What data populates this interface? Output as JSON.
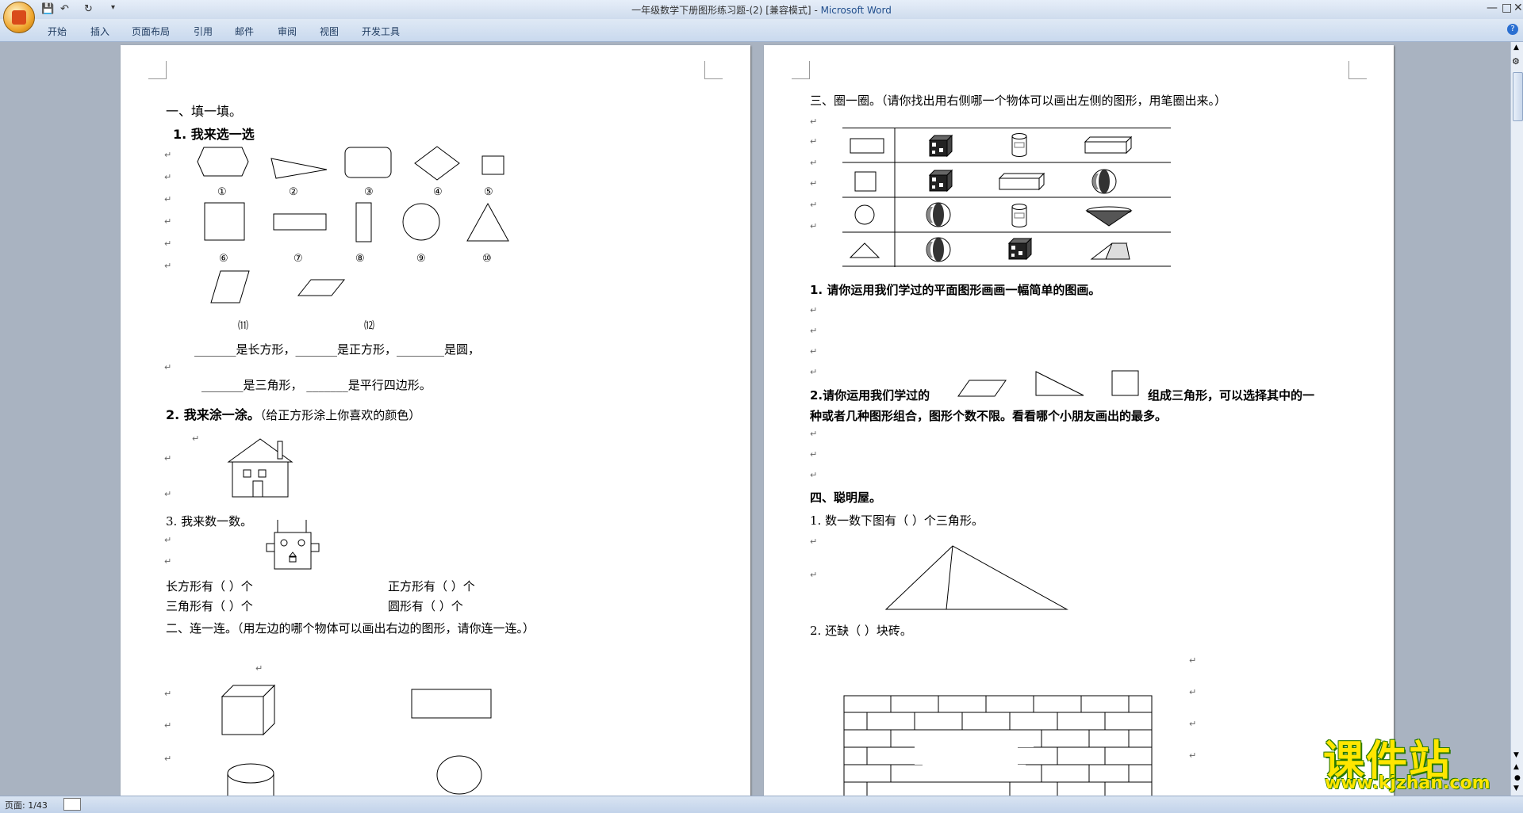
{
  "window": {
    "title": "一年级数学下册图形练习题-(2) [兼容模式]",
    "app_name": "Microsoft Word",
    "quick_access": [
      "save-icon",
      "undo-icon",
      "redo-icon",
      "customize-icon"
    ]
  },
  "menu": {
    "items": [
      "开始",
      "插入",
      "页面布局",
      "引用",
      "邮件",
      "审阅",
      "视图",
      "开发工具"
    ]
  },
  "status": {
    "page": "页面: 1/43"
  },
  "page1": {
    "s1_heading": "一、填一填。",
    "q1_heading": "1. 我来选一选",
    "labels_row1": [
      "①",
      "②",
      "③",
      "④",
      "⑤"
    ],
    "labels_row2": [
      "⑥",
      "⑦",
      "⑧",
      "⑨",
      "⑩"
    ],
    "labels_row3": [
      "⑾",
      "⑿"
    ],
    "fill_line1": "_______是长方形，_______是正方形，________是圆，",
    "fill_line2": "_______是三角形，   _______是平行四边形。",
    "q2_heading": "2. 我来涂一涂。",
    "q2_note": "（给正方形涂上你喜欢的颜色）",
    "q3_heading": "3. 我来数一数。",
    "count_rect": "长方形有（     ）个",
    "count_square": "正方形有（     ）个",
    "count_triangle": "三角形有（     ）个",
    "count_circle": "圆形有（     ）个",
    "s2_heading": "二、连一连。（用左边的哪个物体可以画出右边的图形，请你连一连。）"
  },
  "page2": {
    "s3_heading": "三、圈一圈。（请你找出用右侧哪一个物体可以画出左侧的图形，用笔圈出来。）",
    "q1": "1. 请你运用我们学过的平面图形画画一幅简单的图画。",
    "q2_part1": "2.请你运用我们学过的",
    "q2_part2": "组成三角形，可以选择其中的一",
    "q2_line2": "种或者几种图形组合，图形个数不限。看看哪个小朋友画出的最多。",
    "s4_heading": "四、聪明屋。",
    "s4_q1": "1. 数一数下图有（      ）个三角形。",
    "s4_q2": "2.  还缺（      ）块砖。"
  },
  "watermark": {
    "title": "课件站",
    "url": "www.kjzhan.com"
  }
}
